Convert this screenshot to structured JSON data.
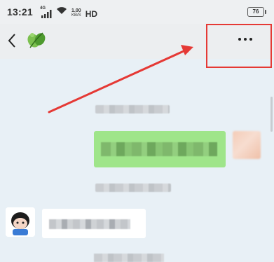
{
  "status_bar": {
    "time": "13:21",
    "network_type": "4G",
    "speed_value": "1.00",
    "speed_unit": "KB/S",
    "hd_label": "HD",
    "battery": "76",
    "icons": [
      "signal-bars-icon",
      "wifi-icon",
      "battery-icon"
    ]
  },
  "nav_bar": {
    "icons": [
      "back-arrow-icon",
      "leaf-logo-icon",
      "more-dots-icon"
    ]
  },
  "annotation": {
    "color": "#e53935"
  },
  "chat": {
    "bubble_mine_color": "#9fe58a",
    "background": "#e8f0f6"
  }
}
